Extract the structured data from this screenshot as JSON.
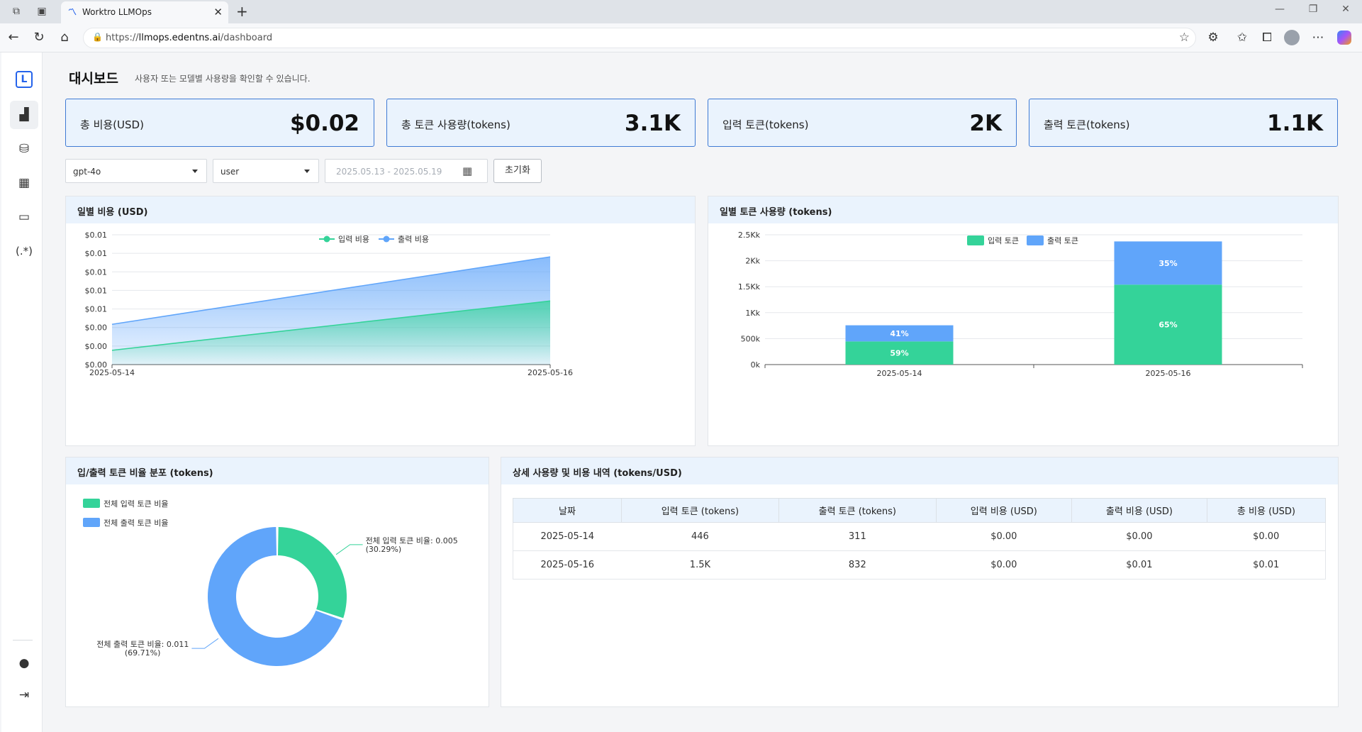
{
  "browser": {
    "tab_title": "Worktro LLMOps",
    "url_prefix": "https://",
    "url_host": "llmops.edentns.ai",
    "url_path": "/dashboard"
  },
  "sidebar": {
    "logo": "L",
    "items": [
      {
        "icon": "chart-icon"
      },
      {
        "icon": "database-icon"
      },
      {
        "icon": "ai-chip-icon"
      },
      {
        "icon": "terminal-icon"
      },
      {
        "icon": "regex-icon",
        "label": "(.*)"
      }
    ],
    "bottom": [
      {
        "icon": "user-icon"
      },
      {
        "icon": "logout-icon"
      }
    ]
  },
  "page": {
    "title": "대시보드",
    "subtitle": "사용자 또는 모델별 사용량을 확인할 수 있습니다."
  },
  "kpis": [
    {
      "label": "총 비용(USD)",
      "value": "$0.02"
    },
    {
      "label": "총 토큰 사용량(tokens)",
      "value": "3.1K"
    },
    {
      "label": "입력 토큰(tokens)",
      "value": "2K"
    },
    {
      "label": "출력 토큰(tokens)",
      "value": "1.1K"
    }
  ],
  "filters": {
    "model": "gpt-4o",
    "user": "user",
    "date_start": "2025.05.13",
    "date_sep": "-",
    "date_end": "2025.05.19",
    "reset_label": "초기화"
  },
  "colors": {
    "input": "#34d399",
    "output": "#60a5fa",
    "accent": "#2563eb"
  },
  "panels": {
    "daily_cost": "일별 비용 (USD)",
    "daily_tokens": "일별 토큰 사용량 (tokens)",
    "ratio": "입/출력 토큰 비율 분포 (tokens)",
    "detail": "상세 사용량 및 비용 내역 (tokens/USD)"
  },
  "chart_data": [
    {
      "type": "area",
      "title": "일별 비용 (USD)",
      "x": [
        "2025-05-14",
        "2025-05-16"
      ],
      "series": [
        {
          "name": "입력 비용",
          "values": [
            0.0011,
            0.0049
          ],
          "color": "#34d399"
        },
        {
          "name": "출력 비용",
          "values": [
            0.0031,
            0.0083
          ],
          "color": "#60a5fa"
        }
      ],
      "ylim": [
        0,
        0.01
      ],
      "yticks": [
        "$0.00",
        "$0.00",
        "$0.00",
        "$0.01",
        "$0.01",
        "$0.01",
        "$0.01",
        "$0.01"
      ],
      "legend": "top-center",
      "grid": true
    },
    {
      "type": "bar",
      "stacked": true,
      "title": "일별 토큰 사용량 (tokens)",
      "categories": [
        "2025-05-14",
        "2025-05-16"
      ],
      "series": [
        {
          "name": "입력 토큰",
          "values": [
            446,
            1540
          ],
          "labels": [
            "59%",
            "65%"
          ],
          "color": "#34d399"
        },
        {
          "name": "출력 토큰",
          "values": [
            311,
            832
          ],
          "labels": [
            "41%",
            "35%"
          ],
          "color": "#60a5fa"
        }
      ],
      "ylim": [
        0,
        2500
      ],
      "yticks": [
        "0k",
        "500k",
        "1Kk",
        "1.5Kk",
        "2Kk",
        "2.5Kk"
      ],
      "legend": "top-center",
      "grid": true
    },
    {
      "type": "pie",
      "donut": true,
      "title": "입/출력 토큰 비율 분포 (tokens)",
      "slices": [
        {
          "name": "전체 입력 토큰 비율",
          "value": 0.005,
          "percent": 30.29,
          "label": "전체 입력 토큰 비율: 0.005",
          "pct_label": "(30.29%)",
          "color": "#34d399"
        },
        {
          "name": "전체 출력 토큰 비율",
          "value": 0.011,
          "percent": 69.71,
          "label": "전체 출력 토큰 비율: 0.011",
          "pct_label": "(69.71%)",
          "color": "#60a5fa"
        }
      ],
      "legend": "top-left"
    },
    {
      "type": "table",
      "title": "상세 사용량 및 비용 내역 (tokens/USD)",
      "columns": [
        "날짜",
        "입력 토큰 (tokens)",
        "출력 토큰 (tokens)",
        "입력 비용 (USD)",
        "출력 비용 (USD)",
        "총 비용 (USD)"
      ],
      "rows": [
        [
          "2025-05-14",
          "446",
          "311",
          "$0.00",
          "$0.00",
          "$0.00"
        ],
        [
          "2025-05-16",
          "1.5K",
          "832",
          "$0.00",
          "$0.01",
          "$0.01"
        ]
      ]
    }
  ]
}
